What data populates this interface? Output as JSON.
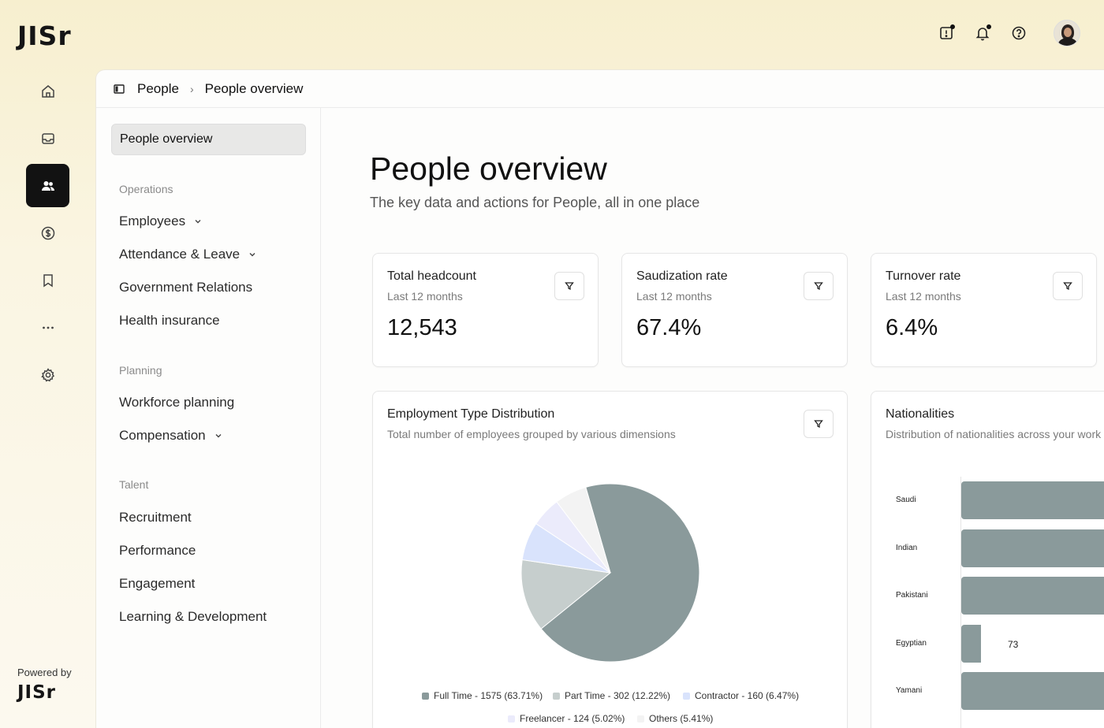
{
  "app": {
    "logo": "JISr",
    "powered_by": "Powered by",
    "powered_logo": "JISr"
  },
  "top_icons": [
    "alert-square-icon",
    "bell-icon",
    "help-circle-icon"
  ],
  "breadcrumb": {
    "root": "People",
    "current": "People overview"
  },
  "subnav": {
    "active": "People overview",
    "sections": [
      {
        "label": "Operations",
        "items": [
          {
            "label": "Employees",
            "expandable": true
          },
          {
            "label": "Attendance & Leave",
            "expandable": true
          },
          {
            "label": "Government Relations",
            "expandable": false
          },
          {
            "label": "Health insurance",
            "expandable": false
          }
        ]
      },
      {
        "label": "Planning",
        "items": [
          {
            "label": "Workforce planning",
            "expandable": false
          },
          {
            "label": "Compensation",
            "expandable": true
          }
        ]
      },
      {
        "label": "Talent",
        "items": [
          {
            "label": "Recruitment",
            "expandable": false
          },
          {
            "label": "Performance",
            "expandable": false
          },
          {
            "label": "Engagement",
            "expandable": false
          },
          {
            "label": "Learning & Development",
            "expandable": false
          }
        ]
      }
    ]
  },
  "page": {
    "title": "People overview",
    "subtitle": "The key data and actions for People, all in one place"
  },
  "kpis": [
    {
      "title": "Total headcount",
      "period": "Last 12 months",
      "value": "12,543"
    },
    {
      "title": "Saudization rate",
      "period": "Last 12 months",
      "value": "67.4%"
    },
    {
      "title": "Turnover rate",
      "period": "Last 12 months",
      "value": "6.4%"
    }
  ],
  "employment_card": {
    "title": "Employment Type Distribution",
    "subtitle": "Total number of employees grouped by various dimensions"
  },
  "nationalities_card": {
    "title": "Nationalities",
    "subtitle": "Distribution of nationalities across your work"
  },
  "chart_data": [
    {
      "type": "pie",
      "title": "",
      "categories": [
        "Full Time",
        "Part Time",
        "Contractor",
        "Freelancer",
        "Others"
      ],
      "values": [
        1575,
        302,
        160,
        124,
        134
      ],
      "legend": [
        "Full Time - 1575 (63.71%)",
        "Part Time - 302 (12.22%)",
        "Contractor - 160 (6.47%)",
        "Freelancer - 124 (5.02%)",
        "Others (5.41%)"
      ],
      "colors": [
        "#8a9a9b",
        "#c6cecd",
        "#d9e3fc",
        "#ebebfb",
        "#f3f3f3"
      ],
      "legend_position": "bottom"
    },
    {
      "type": "bar",
      "orientation": "horizontal",
      "title": "",
      "categories": [
        "Saudi",
        "Indian",
        "Pakistani",
        "Egyptian",
        "Yamani"
      ],
      "values": [
        null,
        null,
        null,
        73,
        null
      ],
      "data_labels": [
        "",
        "",
        "",
        "73",
        ""
      ],
      "relative_lengths": [
        1.0,
        1.0,
        1.0,
        0.12,
        1.0
      ],
      "color": "#8a9a9b"
    }
  ]
}
